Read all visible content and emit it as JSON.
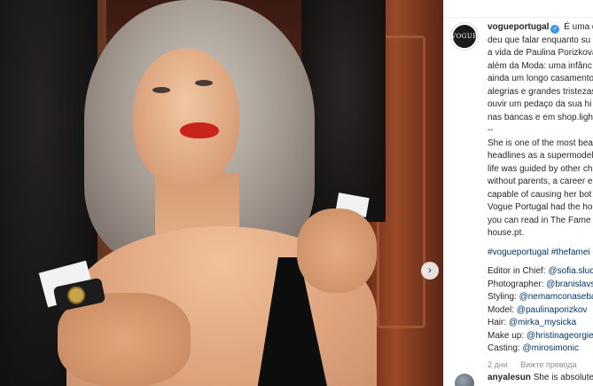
{
  "post": {
    "image_alt": "photo",
    "next_icon": "chevron-right-icon",
    "next_glyph": "›"
  },
  "caption": {
    "avatar_text": "VOGUE",
    "username": "vogueportugal",
    "verified_glyph": "✓",
    "lines": [
      "É uma d",
      "deu que falar enquanto su",
      "a vida de Paulina Porizkova",
      "além da Moda: uma infânc",
      "ainda um longo casamento",
      "alegrias e grandes tristezas",
      "ouvir um pedaço da sua hi",
      "nas bancas e em shop.light",
      "--",
      "She is one of the most bea",
      "headlines as a supermodel",
      "life was guided by other ch",
      "without parents, a career e",
      "capable of causing her bot",
      "Vogue Portugal had the ho",
      "you can read in The Fame",
      "house.pt."
    ],
    "hashtags": "#vogueportugal #thefamei",
    "credits": [
      {
        "label": "Editor in Chief:",
        "value": "@sofia.sluca"
      },
      {
        "label": "Photographer:",
        "value": "@branislavs"
      },
      {
        "label": "Styling:",
        "value": "@nemamconaseba"
      },
      {
        "label": "Model:",
        "value": "@paulinaporizkov"
      },
      {
        "label": "Hair:",
        "value": "@mirka_mysicka"
      },
      {
        "label": "Make up:",
        "value": "@hristinageorgie"
      },
      {
        "label": "Casting:",
        "value": "@mirosimonic"
      }
    ],
    "time_ago": "2 дни",
    "translate": "Вижте превода"
  },
  "comment": {
    "username": "anyalesun",
    "text": "She is absolutely"
  }
}
